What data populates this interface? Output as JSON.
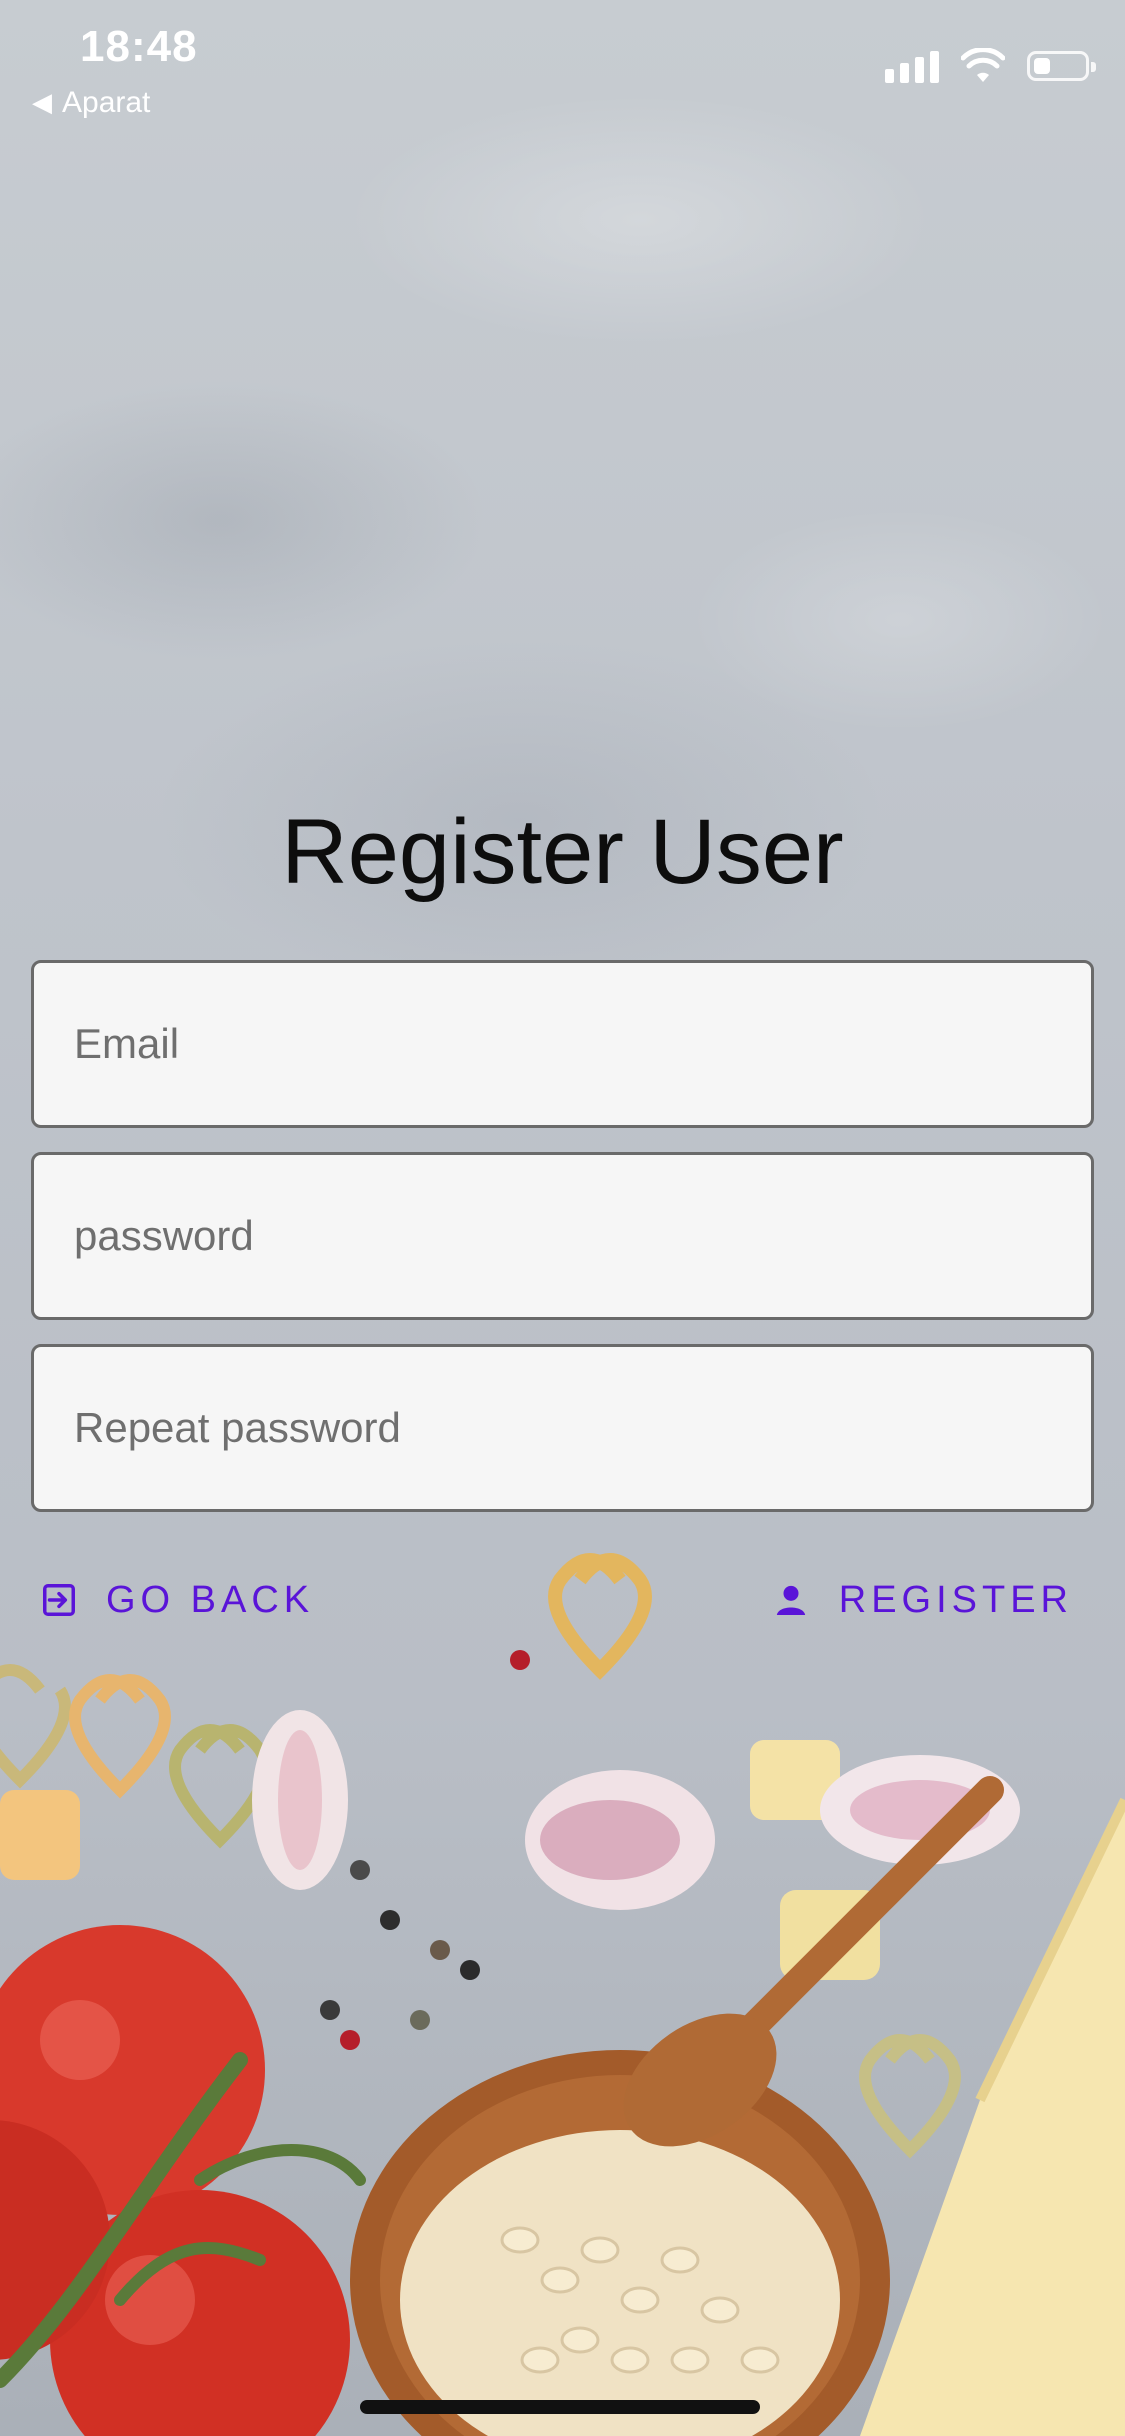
{
  "status_bar": {
    "time": "18:48",
    "back_app": "Aparat",
    "back_icon": "back-triangle-icon"
  },
  "title": "Register User",
  "form": {
    "email_placeholder": "Email",
    "password_placeholder": "password",
    "repeat_password_placeholder": "Repeat password"
  },
  "actions": {
    "go_back_label": "GO BACK",
    "register_label": "REGISTER"
  },
  "colors": {
    "accent": "#5a14d8"
  }
}
